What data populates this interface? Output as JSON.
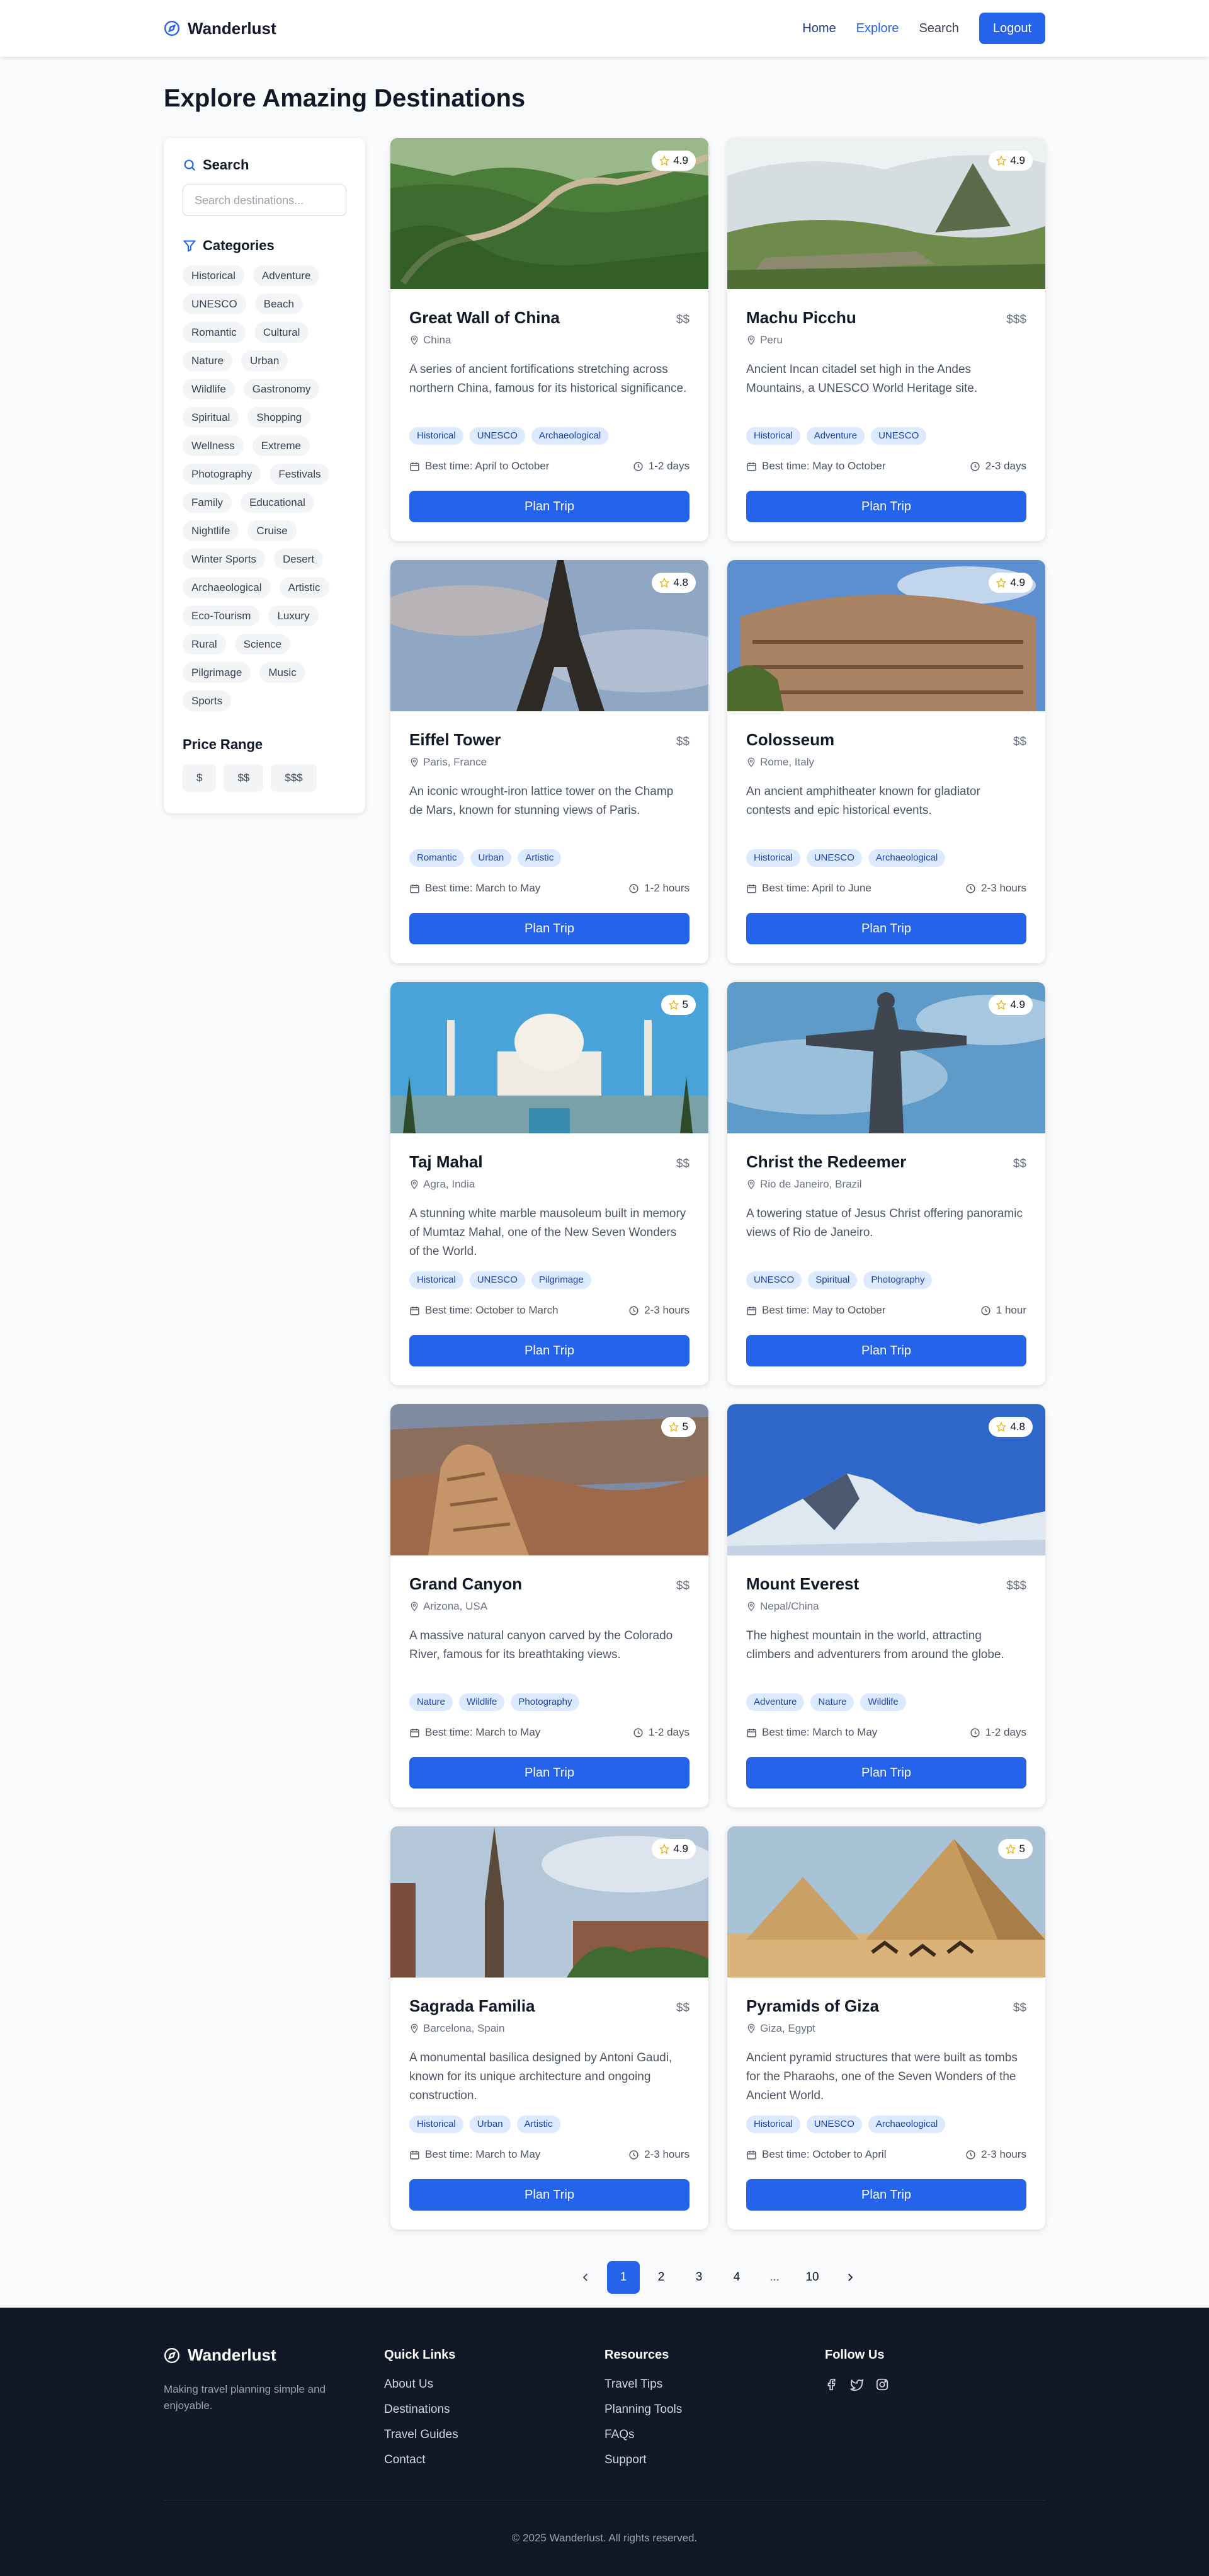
{
  "header": {
    "brand": "Wanderlust",
    "nav": [
      "Home",
      "Explore",
      "Search"
    ],
    "logout_label": "Logout"
  },
  "page_title": "Explore Amazing Destinations",
  "sidebar": {
    "search_heading": "Search",
    "search_placeholder": "Search destinations...",
    "categories_heading": "Categories",
    "categories": [
      "Historical",
      "Adventure",
      "UNESCO",
      "Beach",
      "Romantic",
      "Cultural",
      "Nature",
      "Urban",
      "Wildlife",
      "Gastronomy",
      "Spiritual",
      "Shopping",
      "Wellness",
      "Extreme",
      "Photography",
      "Festivals",
      "Family",
      "Educational",
      "Nightlife",
      "Cruise",
      "Winter Sports",
      "Desert",
      "Archaeological",
      "Artistic",
      "Eco-Tourism",
      "Luxury",
      "Rural",
      "Science",
      "Pilgrimage",
      "Music",
      "Sports"
    ],
    "price_heading": "Price Range",
    "prices": [
      "$",
      "$$",
      "$$$"
    ]
  },
  "cards": [
    {
      "title": "Great Wall of China",
      "price": "$$",
      "location": "China",
      "rating": "4.9",
      "desc": "A series of ancient fortifications stretching across northern China, famous for its historical significance.",
      "tags": [
        "Historical",
        "UNESCO",
        "Archaeological"
      ],
      "best_time": "Best time: April to October",
      "duration": "1-2 days",
      "button": "Plan Trip"
    },
    {
      "title": "Machu Picchu",
      "price": "$$$",
      "location": "Peru",
      "rating": "4.9",
      "desc": "Ancient Incan citadel set high in the Andes Mountains, a UNESCO World Heritage site.",
      "tags": [
        "Historical",
        "Adventure",
        "UNESCO"
      ],
      "best_time": "Best time: May to October",
      "duration": "2-3 days",
      "button": "Plan Trip"
    },
    {
      "title": "Eiffel Tower",
      "price": "$$",
      "location": "Paris, France",
      "rating": "4.8",
      "desc": "An iconic wrought-iron lattice tower on the Champ de Mars, known for stunning views of Paris.",
      "tags": [
        "Romantic",
        "Urban",
        "Artistic"
      ],
      "best_time": "Best time: March to May",
      "duration": "1-2 hours",
      "button": "Plan Trip"
    },
    {
      "title": "Colosseum",
      "price": "$$",
      "location": "Rome, Italy",
      "rating": "4.9",
      "desc": "An ancient amphitheater known for gladiator contests and epic historical events.",
      "tags": [
        "Historical",
        "UNESCO",
        "Archaeological"
      ],
      "best_time": "Best time: April to June",
      "duration": "2-3 hours",
      "button": "Plan Trip"
    },
    {
      "title": "Taj Mahal",
      "price": "$$",
      "location": "Agra, India",
      "rating": "5",
      "desc": "A stunning white marble mausoleum built in memory of Mumtaz Mahal, one of the New Seven Wonders of the World.",
      "tags": [
        "Historical",
        "UNESCO",
        "Pilgrimage"
      ],
      "best_time": "Best time: October to March",
      "duration": "2-3 hours",
      "button": "Plan Trip"
    },
    {
      "title": "Christ the Redeemer",
      "price": "$$",
      "location": "Rio de Janeiro, Brazil",
      "rating": "4.9",
      "desc": "A towering statue of Jesus Christ offering panoramic views of Rio de Janeiro.",
      "tags": [
        "UNESCO",
        "Spiritual",
        "Photography"
      ],
      "best_time": "Best time: May to October",
      "duration": "1 hour",
      "button": "Plan Trip"
    },
    {
      "title": "Grand Canyon",
      "price": "$$",
      "location": "Arizona, USA",
      "rating": "5",
      "desc": "A massive natural canyon carved by the Colorado River, famous for its breathtaking views.",
      "tags": [
        "Nature",
        "Wildlife",
        "Photography"
      ],
      "best_time": "Best time: March to May",
      "duration": "1-2 days",
      "button": "Plan Trip"
    },
    {
      "title": "Mount Everest",
      "price": "$$$",
      "location": "Nepal/China",
      "rating": "4.8",
      "desc": "The highest mountain in the world, attracting climbers and adventurers from around the globe.",
      "tags": [
        "Adventure",
        "Nature",
        "Wildlife"
      ],
      "best_time": "Best time: March to May",
      "duration": "1-2 days",
      "button": "Plan Trip"
    },
    {
      "title": "Sagrada Familia",
      "price": "$$",
      "location": "Barcelona, Spain",
      "rating": "4.9",
      "desc": "A monumental basilica designed by Antoni Gaudi, known for its unique architecture and ongoing construction.",
      "tags": [
        "Historical",
        "Urban",
        "Artistic"
      ],
      "best_time": "Best time: March to May",
      "duration": "2-3 hours",
      "button": "Plan Trip"
    },
    {
      "title": "Pyramids of Giza",
      "price": "$$",
      "location": "Giza, Egypt",
      "rating": "5",
      "desc": "Ancient pyramid structures that were built as tombs for the Pharaohs, one of the Seven Wonders of the Ancient World.",
      "tags": [
        "Historical",
        "UNESCO",
        "Archaeological"
      ],
      "best_time": "Best time: October to April",
      "duration": "2-3 hours",
      "button": "Plan Trip"
    }
  ],
  "pagination": {
    "pages": [
      "1",
      "2",
      "3",
      "4"
    ],
    "ellipsis": "...",
    "last": "10",
    "current": "1"
  },
  "footer": {
    "brand": "Wanderlust",
    "tagline": "Making travel planning simple and enjoyable.",
    "quick_links_heading": "Quick Links",
    "quick_links": [
      "About Us",
      "Destinations",
      "Travel Guides",
      "Contact"
    ],
    "resources_heading": "Resources",
    "resources": [
      "Travel Tips",
      "Planning Tools",
      "FAQs",
      "Support"
    ],
    "follow_heading": "Follow Us",
    "copyright": "© 2025 Wanderlust. All rights reserved."
  },
  "colors": {
    "primary": "#2563eb",
    "footer_bg": "#111827",
    "tag_bg": "#dbeafe",
    "star": "#facc15"
  }
}
